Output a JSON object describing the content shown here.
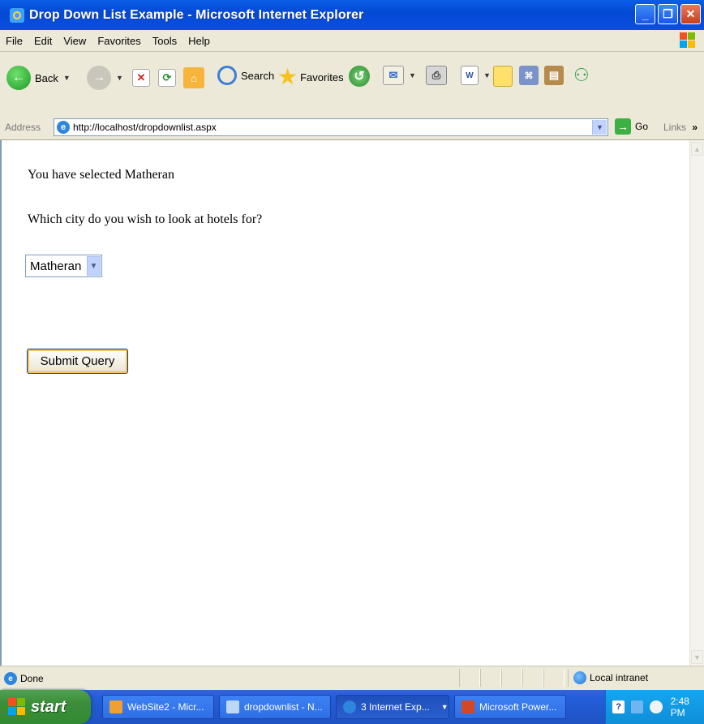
{
  "window": {
    "title": "Drop Down List Example - Microsoft Internet Explorer"
  },
  "menu": [
    "File",
    "Edit",
    "View",
    "Favorites",
    "Tools",
    "Help"
  ],
  "toolbar": {
    "back_label": "Back",
    "search_label": "Search",
    "favorites_label": "Favorites"
  },
  "address": {
    "label": "Address",
    "url": "http://localhost/dropdownlist.aspx",
    "go_label": "Go",
    "links_label": "Links",
    "links_chevron": "»"
  },
  "page": {
    "message": "You have selected Matheran",
    "question": "Which city do you wish to look at hotels for?",
    "city_select": {
      "selected": "Matheran"
    },
    "submit_label": "Submit Query"
  },
  "status": {
    "text": "Done",
    "zone": "Local intranet"
  },
  "taskbar": {
    "start_label": "start",
    "tasks": [
      {
        "label": "WebSite2 - Micr..."
      },
      {
        "label": "dropdownlist - N..."
      },
      {
        "label": "3 Internet Exp..."
      },
      {
        "label": "Microsoft Power..."
      }
    ],
    "clock": "2:48 PM"
  }
}
